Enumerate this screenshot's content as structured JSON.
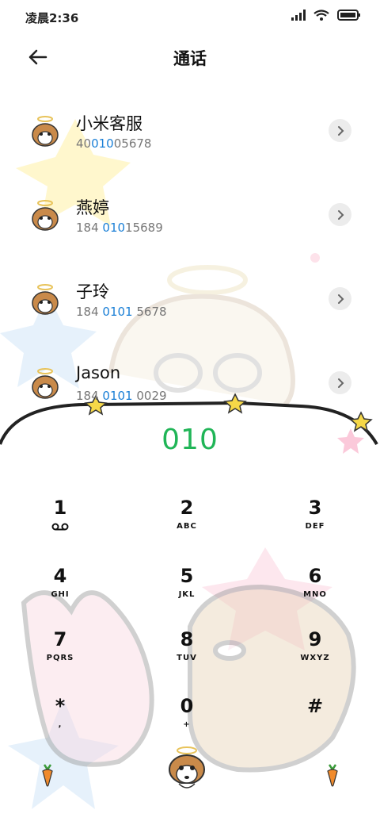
{
  "status_bar": {
    "time": "凌晨2:36"
  },
  "header": {
    "title": "通话"
  },
  "contacts": [
    {
      "name": "小米客服",
      "number_parts": [
        "40",
        "010",
        "05678"
      ]
    },
    {
      "name": "燕婷",
      "number_parts": [
        "184 ",
        "010",
        "15689"
      ]
    },
    {
      "name": "子玲",
      "number_parts": [
        "184 ",
        "0101",
        " 5678"
      ]
    },
    {
      "name": "Jason",
      "number_parts": [
        "184 ",
        "0101",
        " 0029"
      ]
    }
  ],
  "dialer": {
    "number": "010",
    "keys": [
      {
        "digit": "1",
        "letters": ""
      },
      {
        "digit": "2",
        "letters": "ABC"
      },
      {
        "digit": "3",
        "letters": "DEF"
      },
      {
        "digit": "4",
        "letters": "GHI"
      },
      {
        "digit": "5",
        "letters": "JKL"
      },
      {
        "digit": "6",
        "letters": "MNO"
      },
      {
        "digit": "7",
        "letters": "PQRS"
      },
      {
        "digit": "8",
        "letters": "TUV"
      },
      {
        "digit": "9",
        "letters": "WXYZ"
      },
      {
        "digit": "*",
        "letters": ","
      },
      {
        "digit": "0",
        "letters": "+"
      },
      {
        "digit": "#",
        "letters": ""
      }
    ]
  },
  "icons": {
    "back": "arrow-left-icon",
    "voicemail": "voicemail-icon",
    "chevron": "chevron-right-icon",
    "call": "dog-call-icon",
    "carrot_left": "carrot-icon",
    "carrot_right": "carrot-icon"
  },
  "colors": {
    "dial_number": "#20b557",
    "match_highlight": "#1a7fd6"
  }
}
